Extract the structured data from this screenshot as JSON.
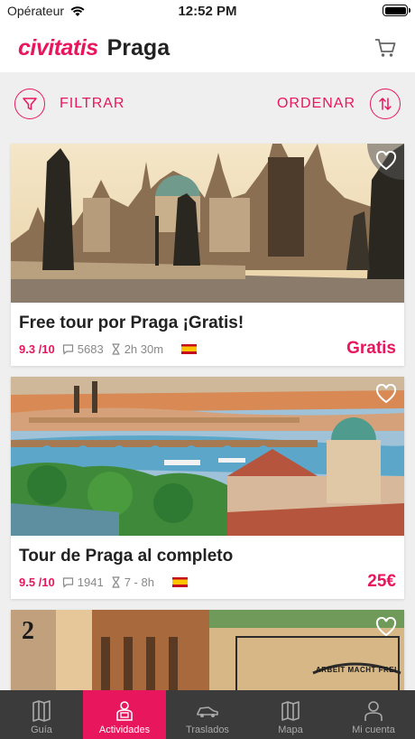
{
  "status": {
    "carrier": "Opérateur",
    "time": "12:52 PM"
  },
  "header": {
    "brand": "civitatis",
    "city": "Praga",
    "cart_icon": "cart-icon"
  },
  "toolbar": {
    "filter_label": "FILTRAR",
    "order_label": "ORDENAR"
  },
  "colors": {
    "accent": "#e8175d",
    "tabbar": "#3b3b3b"
  },
  "activities": [
    {
      "title": "Free tour por Praga ¡Gratis!",
      "rating": "9.3 /10",
      "reviews": "5683",
      "duration": "2h 30m",
      "price": "Gratis"
    },
    {
      "title": "Tour de Praga al completo",
      "rating": "9.5 /10",
      "reviews": "1941",
      "duration": "7 - 8h",
      "price": "25€"
    }
  ],
  "third_card": {
    "sign_text": "ARBEIT MACHT FREI",
    "number": "2"
  },
  "tabs": [
    {
      "label": "Guía",
      "icon": "map-book-icon"
    },
    {
      "label": "Actividades",
      "icon": "person-icon"
    },
    {
      "label": "Traslados",
      "icon": "car-icon"
    },
    {
      "label": "Mapa",
      "icon": "map-icon"
    },
    {
      "label": "Mi cuenta",
      "icon": "account-icon"
    }
  ]
}
